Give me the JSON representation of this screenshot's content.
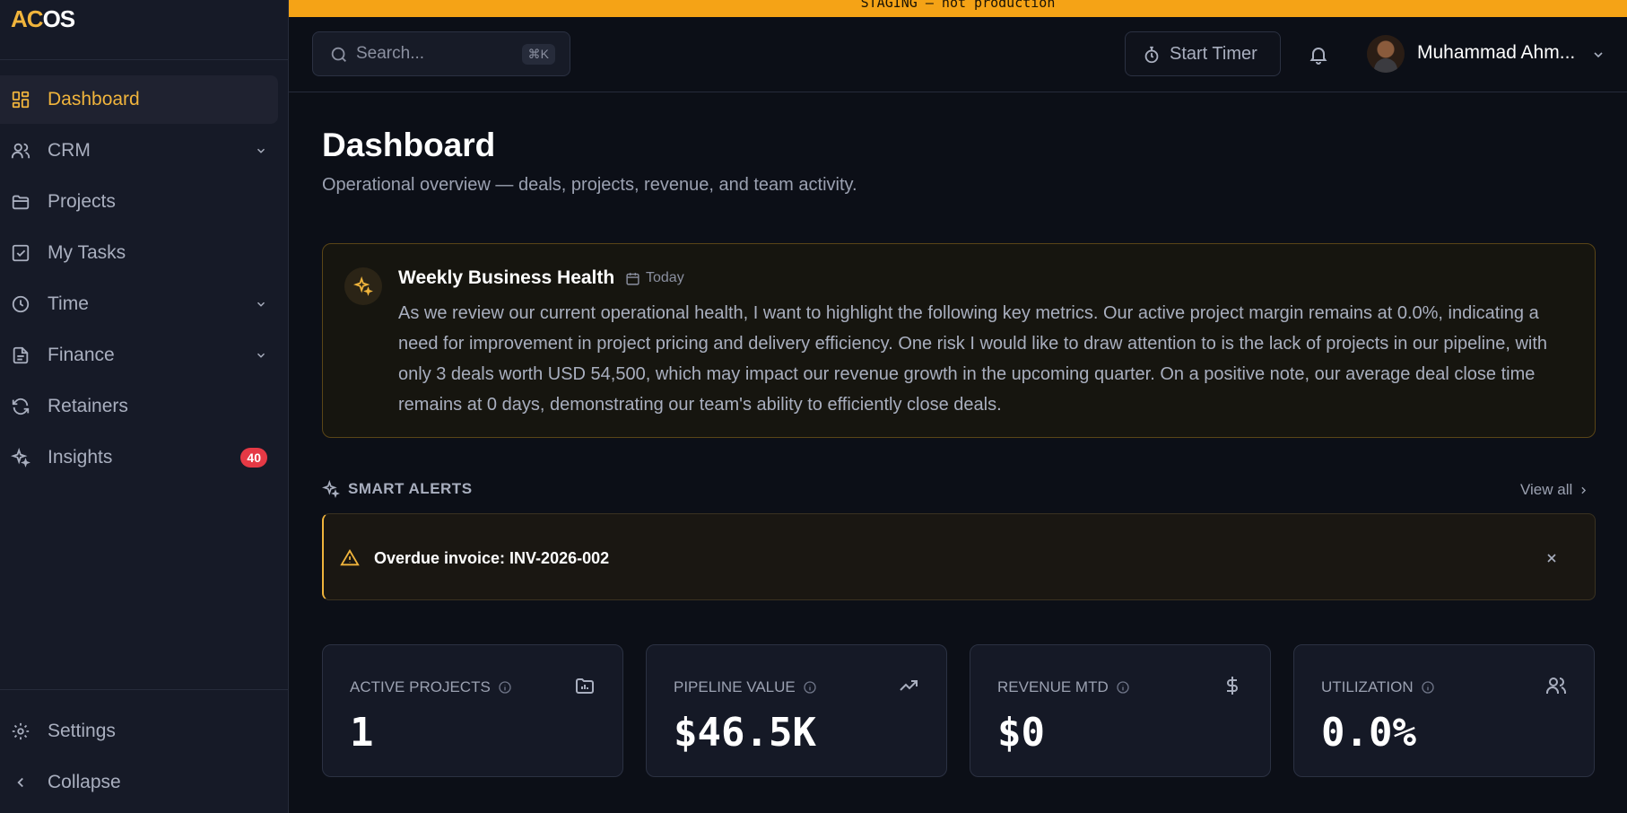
{
  "logo": {
    "part1": "AC",
    "part2": "OS"
  },
  "banner": "STAGING — not production",
  "sidebar": {
    "items": [
      {
        "label": "Dashboard",
        "icon": "grid-icon"
      },
      {
        "label": "CRM",
        "icon": "users-icon"
      },
      {
        "label": "Projects",
        "icon": "folder-icon"
      },
      {
        "label": "My Tasks",
        "icon": "checkbox-icon"
      },
      {
        "label": "Time",
        "icon": "clock-icon"
      },
      {
        "label": "Finance",
        "icon": "file-text-icon"
      },
      {
        "label": "Retainers",
        "icon": "refresh-icon"
      },
      {
        "label": "Insights",
        "icon": "sparkles-icon",
        "badge": "40"
      }
    ],
    "bottom": [
      {
        "label": "Settings",
        "icon": "gear-icon"
      },
      {
        "label": "Collapse",
        "icon": "chevron-left-icon"
      }
    ]
  },
  "topbar": {
    "search_placeholder": "Search...",
    "search_shortcut": "⌘K",
    "timer_label": "Start Timer",
    "user_name": "Muhammad Ahm..."
  },
  "page": {
    "title": "Dashboard",
    "subtitle": "Operational overview — deals, projects, revenue, and team activity."
  },
  "health": {
    "title": "Weekly Business Health",
    "date": "Today",
    "body": "As we review our current operational health, I want to highlight the following key metrics. Our active project margin remains at 0.0%, indicating a need for improvement in project pricing and delivery efficiency. One risk I would like to draw attention to is the lack of projects in our pipeline, with only 3 deals worth USD 54,500, which may impact our revenue growth in the upcoming quarter. On a positive note, our average deal close time remains at 0 days, demonstrating our team's ability to efficiently close deals."
  },
  "alerts": {
    "heading": "SMART ALERTS",
    "view_all": "View all",
    "items": [
      {
        "text": "Overdue invoice: INV-2026-002"
      }
    ]
  },
  "cards": [
    {
      "label": "ACTIVE PROJECTS",
      "value": "1",
      "icon": "folder-chart-icon"
    },
    {
      "label": "PIPELINE VALUE",
      "value": "$46.5K",
      "icon": "trending-up-icon"
    },
    {
      "label": "REVENUE MTD",
      "value": "$0",
      "icon": "dollar-icon"
    },
    {
      "label": "UTILIZATION",
      "value": "0.0%",
      "icon": "users-icon"
    }
  ],
  "colors": {
    "accent": "#f0b43c",
    "banner": "#f5a316",
    "badge": "#e53945",
    "background": "#0c0f17",
    "sidebar": "#161a27"
  }
}
